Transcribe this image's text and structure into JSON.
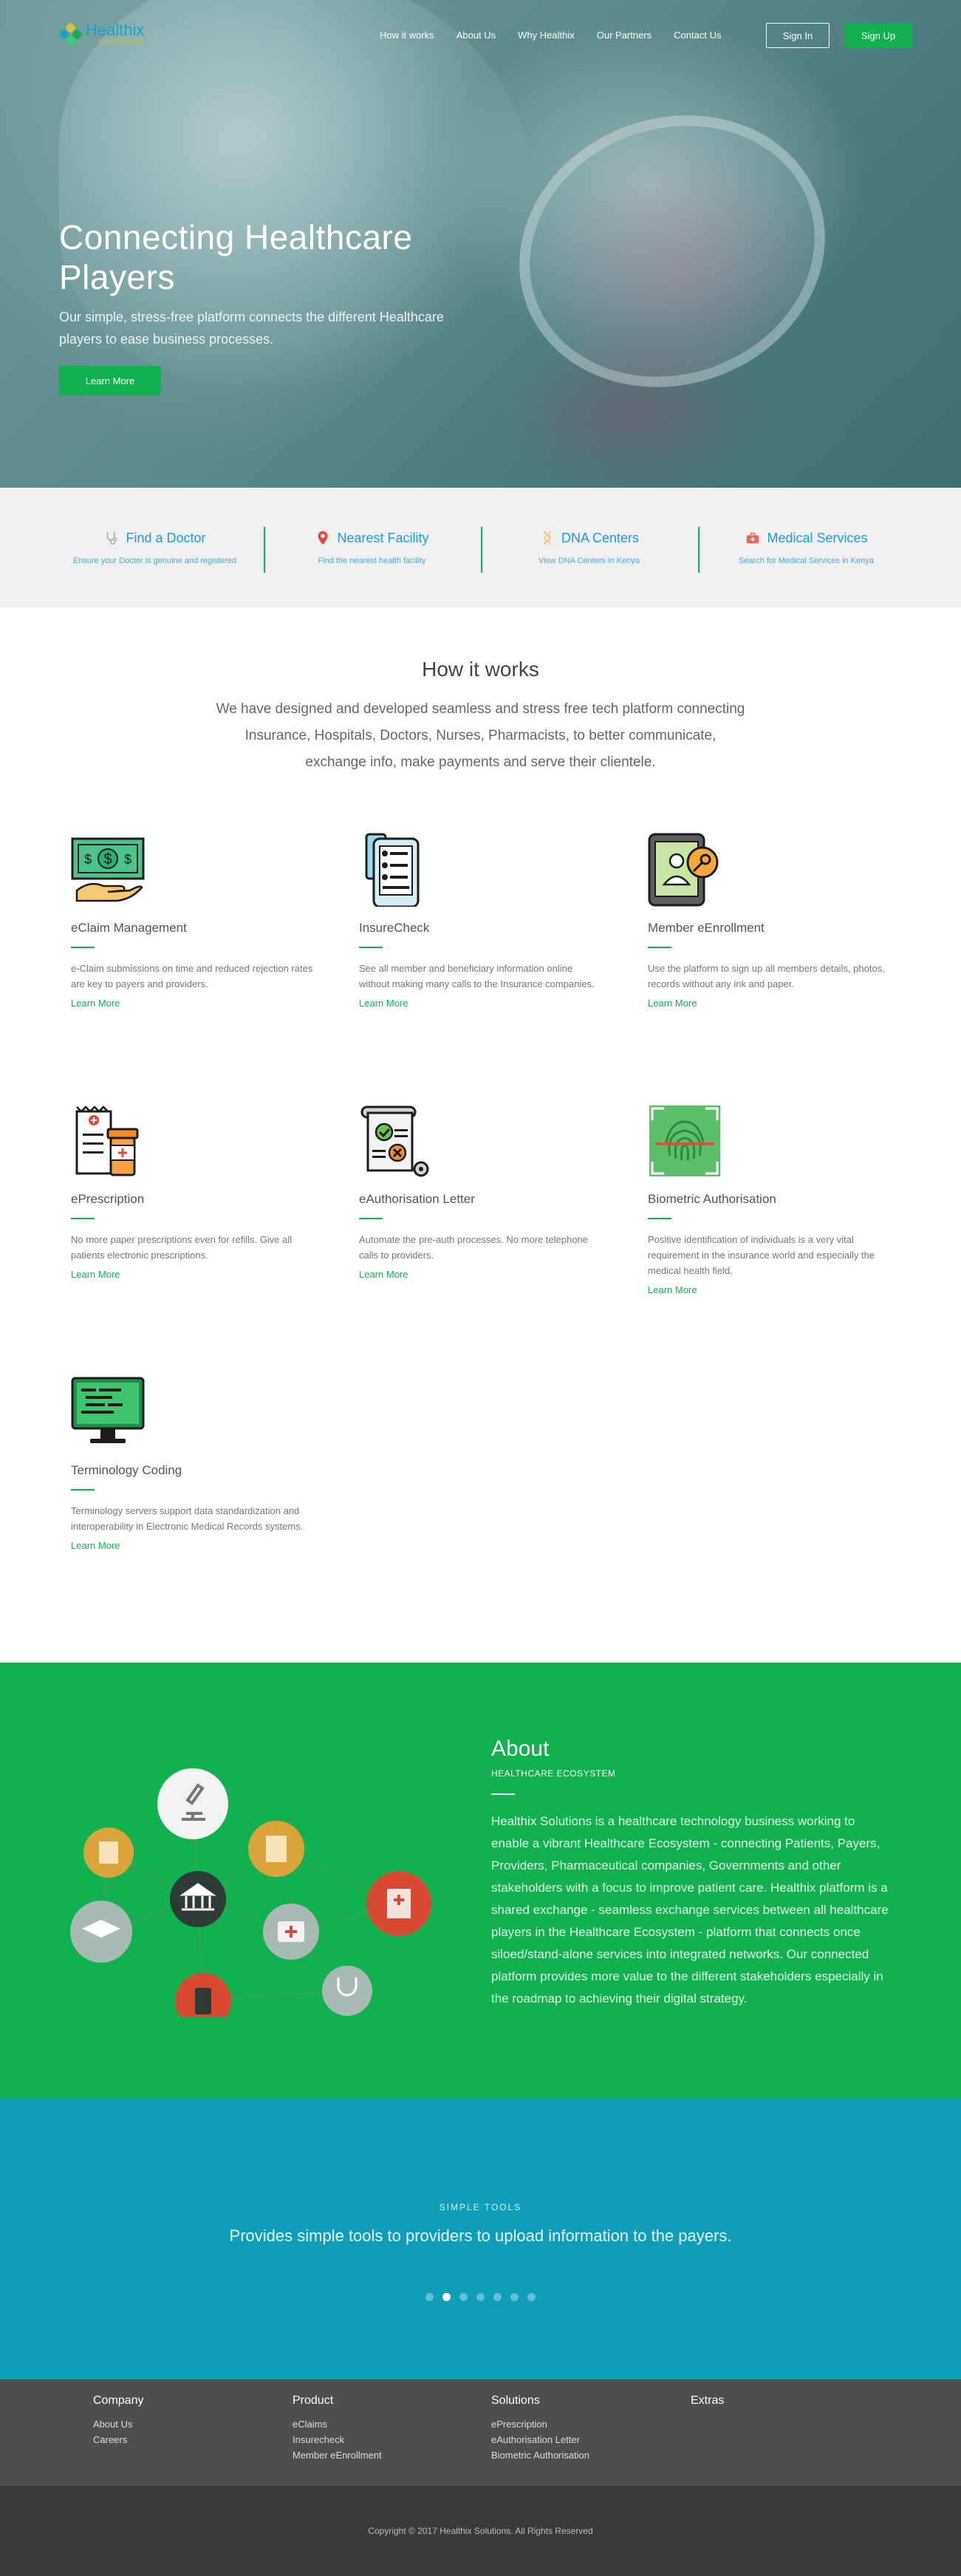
{
  "brand": {
    "name": "Healthix",
    "tagline": "SOLUTIONS"
  },
  "nav": {
    "links": [
      "How it works",
      "About Us",
      "Why Healthix",
      "Our Partners",
      "Contact Us"
    ],
    "signin": "Sign In",
    "signup": "Sign Up"
  },
  "hero": {
    "title": "Connecting Healthcare Players",
    "subtitle": "Our simple, stress-free platform connects the different Healthcare players to ease business processes.",
    "cta": "Learn More"
  },
  "quick": [
    {
      "title": "Find a Doctor",
      "desc": "Ensure your Doctor is genuine and registered",
      "icon": "stethoscope-icon"
    },
    {
      "title": "Nearest Facility",
      "desc": "Find the nearest health facility",
      "icon": "map-pin-icon"
    },
    {
      "title": "DNA Centers",
      "desc": "View DNA Centers in Kenya",
      "icon": "dna-icon"
    },
    {
      "title": "Medical Services",
      "desc": "Search for Medical Services in Kenya",
      "icon": "medical-bag-icon"
    }
  ],
  "how": {
    "title": "How it works",
    "lead": "We have designed and developed seamless and stress free tech platform connecting Insurance, Hospitals, Doctors, Nurses, Pharmacists, to better communicate, exchange info, make payments and serve their clientele.",
    "features": [
      {
        "title": "eClaim Management",
        "desc": "e-Claim submissions on time and reduced rejection rates are key to payers and providers.",
        "link": "Learn More",
        "icon": "money-hand-icon"
      },
      {
        "title": "InsureCheck",
        "desc": "See all member and beneficiary information online without making many calls to the Insurance companies.",
        "link": "Learn More",
        "icon": "phone-document-icon"
      },
      {
        "title": "Member eEnrollment",
        "desc": "Use the platform to sign up all members details, photos, records without any ink and paper.",
        "link": "Learn More",
        "icon": "tablet-user-icon"
      },
      {
        "title": "ePrescription",
        "desc": "No more paper prescriptions even for refills. Give all patients electronic prescriptions.",
        "link": "Learn More",
        "icon": "prescription-icon"
      },
      {
        "title": "eAuthorisation Letter",
        "desc": "Automate the pre-auth processes. No more telephone calls to providers.",
        "link": "Learn More",
        "icon": "authorisation-scroll-icon"
      },
      {
        "title": "Biometric Authorisation",
        "desc": "Positive identification of individuals is a very vital requirement in the insurance world and especially the medical health field.",
        "link": "Learn More",
        "icon": "fingerprint-icon"
      },
      {
        "title": "Terminology Coding",
        "desc": "Terminology servers support data standardization and interoperability in Electronic Medical Records systems.",
        "link": "Learn More",
        "icon": "monitor-code-icon"
      }
    ]
  },
  "about": {
    "title": "About",
    "subtitle": "HEALTHCARE ECOSYSTEM",
    "text": "Healthix Solutions is a healthcare technology business working to enable a vibrant Healthcare Ecosystem - connecting Patients, Payers, Providers, Pharmaceutical companies, Governments and other stakeholders with a focus to improve patient care. Healthix platform is a shared exchange - seamless exchange services between all healthcare players in the Healthcare Ecosystem - platform that connects once siloed/stand-alone services into integrated networks. Our connected platform provides more value to the different stakeholders especially in the roadmap to achieving their digital strategy."
  },
  "tools": {
    "kicker": "SIMPLE TOOLS",
    "message": "Provides simple tools to providers to upload information to the payers.",
    "slides": 7,
    "active_slide": 2
  },
  "footer": {
    "columns": [
      {
        "title": "Company",
        "links": [
          "About Us",
          "Careers"
        ]
      },
      {
        "title": "Product",
        "links": [
          "eClaims",
          "Insurecheck",
          "Member eEnrollment"
        ]
      },
      {
        "title": "Solutions",
        "links": [
          "ePrescription",
          "eAuthorisation Letter",
          "Biometric Authorisation"
        ]
      },
      {
        "title": "Extras",
        "links": []
      }
    ],
    "copyright": "Copyright © 2017 Healthix Solutions. All Rights Reserved"
  },
  "colors": {
    "accent": "#12b14f",
    "link": "#1a9fd0",
    "tools_bg": "#0f9eba",
    "footer_bg": "#4e4e4e"
  }
}
